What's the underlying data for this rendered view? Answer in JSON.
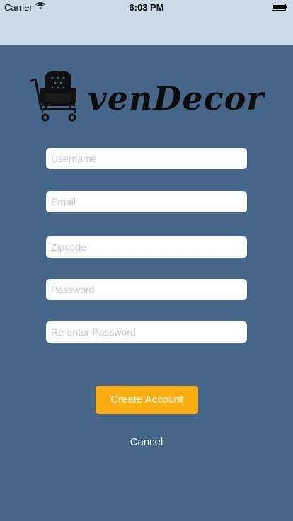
{
  "status_bar": {
    "carrier": "Carrier",
    "time": "6:03 PM",
    "wifi_icon": "wifi-icon",
    "battery_icon": "battery-icon"
  },
  "brand": {
    "name": "venDecor",
    "logo_icon": "armchair-cart-icon"
  },
  "form": {
    "username_placeholder": "Username",
    "email_placeholder": "Email",
    "zipcode_placeholder": "Zipcode",
    "password_placeholder": "Password",
    "reenter_password_placeholder": "Re-enter Password"
  },
  "actions": {
    "create_label": "Create Account",
    "cancel_label": "Cancel"
  },
  "colors": {
    "background": "#46678a",
    "header": "#ccd9e6",
    "accent": "#fbad12",
    "field": "#ffffff"
  }
}
